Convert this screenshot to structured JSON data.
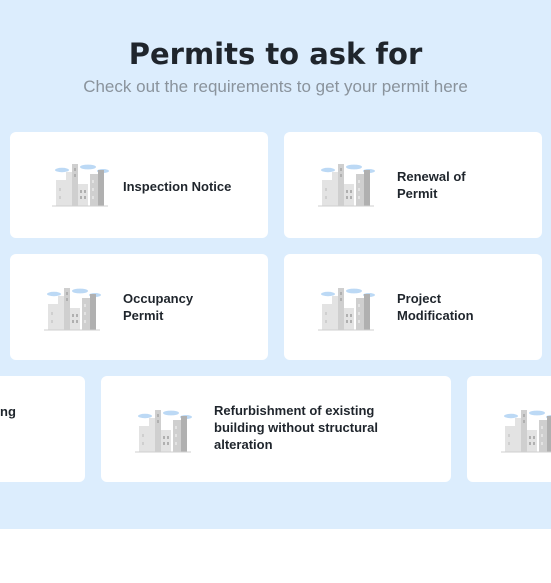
{
  "header": {
    "title": "Permits to ask for",
    "subtitle": "Check out the requirements to get your permit here"
  },
  "permits": [
    {
      "label": "Inspection Notice",
      "icon": "building-illustration-icon"
    },
    {
      "label": "Renewal of\nPermit",
      "icon": "building-illustration-icon"
    },
    {
      "label": "Occupancy\nPermit",
      "icon": "building-illustration-icon"
    },
    {
      "label": "Project\nModification",
      "icon": "building-illustration-icon"
    },
    {
      "label": "ng",
      "icon": "building-illustration-icon"
    },
    {
      "label": "Refurbishment of existing\nbuilding without structural\nalteration",
      "icon": "building-illustration-icon"
    },
    {
      "label": "",
      "icon": "building-illustration-icon"
    }
  ],
  "colors": {
    "section_bg": "#dcedfd",
    "card_bg": "#ffffff",
    "title": "#1f252c",
    "subtitle": "#8a939c",
    "cloud": "#bcd9f5",
    "building_light": "#e3e3e3",
    "building_mid": "#cfcfcf",
    "building_dark": "#b0b0b0"
  }
}
